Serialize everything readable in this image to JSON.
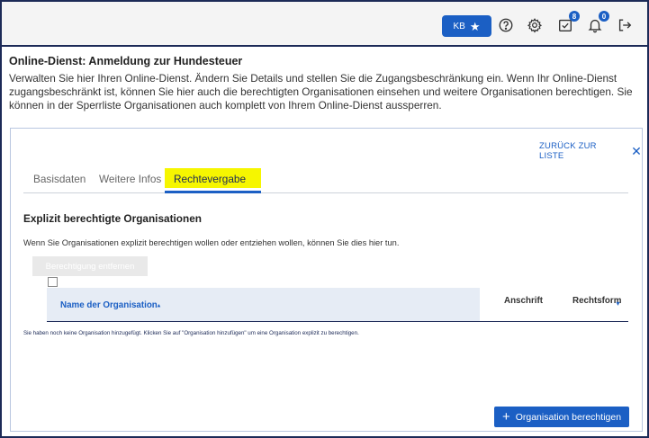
{
  "topbar": {
    "kb_label": "KB",
    "icons": [
      "star-icon",
      "help-icon",
      "gear-icon",
      "tasks-icon",
      "bell-icon",
      "logout-icon"
    ],
    "tasks_badge": "8",
    "notifications_badge": "0"
  },
  "header": {
    "title": "Online-Dienst: Anmeldung zur Hundesteuer",
    "description": "Verwalten Sie hier Ihren Online-Dienst. Ändern Sie Details und stellen Sie die Zugangsbeschränkung ein. Wenn Ihr Online-Dienst zugangsbeschränkt ist, können Sie hier auch die berechtigten Organisationen einsehen und weitere Organisationen berechtigen. Sie können in der Sperrliste Organisationen auch komplett von Ihrem Online-Dienst aussperren."
  },
  "card": {
    "back_label": "ZURÜCK ZUR LISTE",
    "close_glyph": "✕",
    "tabs": [
      {
        "label": "Basisdaten",
        "active": false
      },
      {
        "label": "Weitere Infos",
        "active": false
      },
      {
        "label": "Rechtevergabe",
        "active": true
      }
    ],
    "section_title": "Explizit berechtigte Organisationen",
    "section_desc": "Wenn Sie Organisationen explizit berechtigen wollen oder entziehen wollen, können Sie dies hier tun.",
    "remove_button": "Berechtigung entfernen",
    "table": {
      "columns": [
        "Name der Organisation",
        "Anschrift",
        "Rechtsform"
      ]
    },
    "empty_message": "Sie haben noch keine Organisation hinzugefügt. Klicken Sie auf \"Organisation hinzufügen\" um eine Organisation explizit zu berechtigen.",
    "add_button": "Organisation berechtigen"
  },
  "colors": {
    "accent": "#1b5fc4",
    "highlight": "#f6f600",
    "border": "#1c2a57"
  }
}
